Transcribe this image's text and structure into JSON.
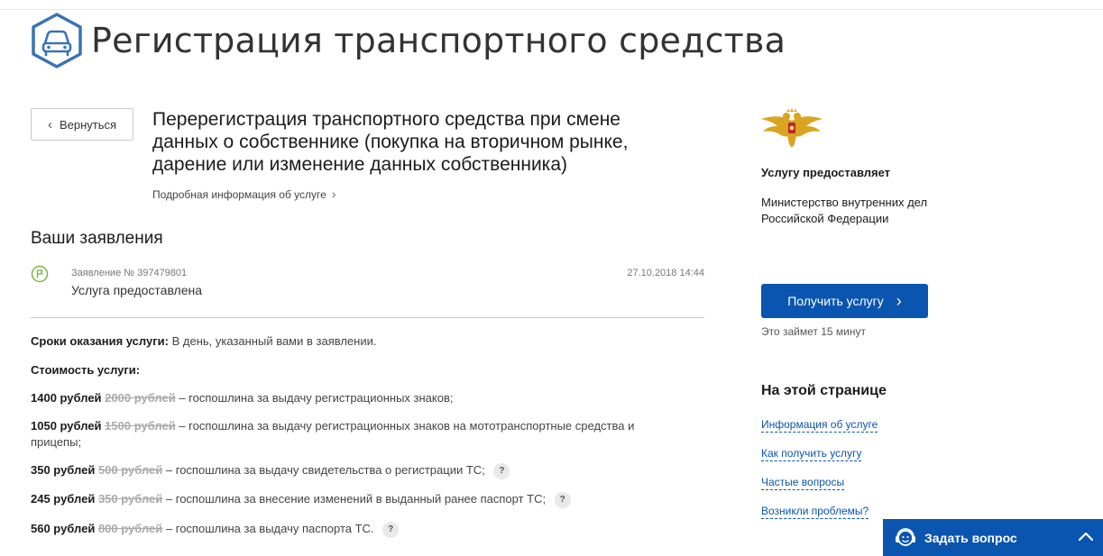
{
  "header": {
    "icon": "car-icon",
    "title": "Регистрация транспортного средства"
  },
  "back_button": {
    "label": "Вернуться",
    "icon": "chevron-left-icon"
  },
  "service": {
    "title": "Перерегистрация транспортного средства при смене данных о собственнике (покупка на вторичном рынке, дарение или изменение данных собственника)",
    "details_link": "Подробная информация об услуге"
  },
  "applications": {
    "heading": "Ваши заявления",
    "items": [
      {
        "number": "Заявление № 397479801",
        "status": "Услуга предоставлена",
        "date": "27.10.2018 14:44"
      }
    ]
  },
  "terms": {
    "label": "Сроки оказания услуги:",
    "value": "В день, указанный вами в заявлении."
  },
  "cost": {
    "label": "Стоимость услуги:",
    "items": [
      {
        "price": "1400 рублей",
        "old_price": "2000 рублей",
        "description": "– госпошлина за выдачу регистрационных знаков;",
        "has_help": false
      },
      {
        "price": "1050 рублей",
        "old_price": "1500 рублей",
        "description": "– госпошлина за выдачу регистрационных знаков на мототранспортные средства и прицепы;",
        "has_help": false
      },
      {
        "price": "350 рублей",
        "old_price": "500 рублей",
        "description": "– госпошлина за выдачу свидетельства о регистрации ТС;",
        "has_help": true
      },
      {
        "price": "245 рублей",
        "old_price": "350 рублей",
        "description": "– госпошлина за внесение изменений в выданный ранее паспорт ТС;",
        "has_help": true
      },
      {
        "price": "560 рублей",
        "old_price": "800 рублей",
        "description": "– госпошлина за выдачу паспорта ТС.",
        "has_help": true
      }
    ],
    "help_symbol": "?"
  },
  "provider": {
    "label": "Услугу предоставляет",
    "name": "Министерство внутренних дел Российской Федерации",
    "emblem": "coat-of-arms-icon"
  },
  "action": {
    "button_label": "Получить услугу",
    "duration": "Это займет 15 минут"
  },
  "toc": {
    "heading": "На этой странице",
    "links": [
      "Информация об услуге",
      "Как получить услугу",
      "Частые вопросы",
      "Возникли проблемы?"
    ]
  },
  "ask": {
    "label": "Задать вопрос",
    "icon": "support-agent-icon"
  },
  "colors": {
    "accent": "#0a55b0",
    "icon_blue": "#3a72b7",
    "status_green": "#7ab648",
    "emblem_gold": "#d9a520"
  }
}
